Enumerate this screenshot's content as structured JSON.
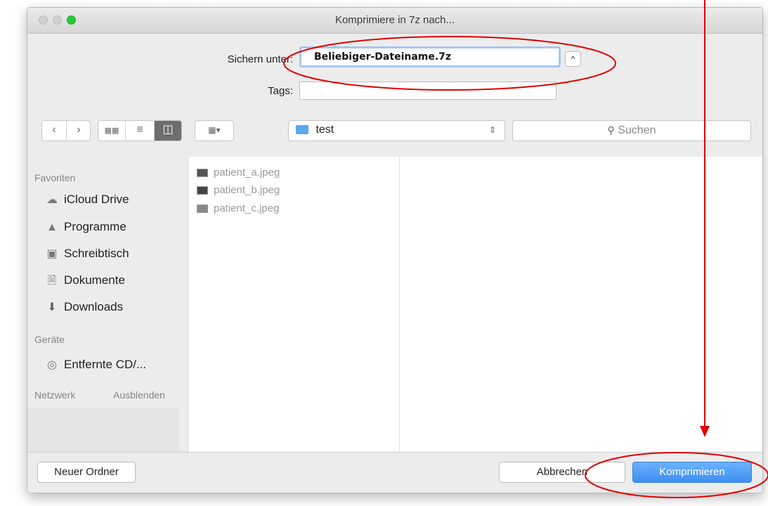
{
  "window": {
    "title": "Komprimiere in 7z nach..."
  },
  "save": {
    "label": "Sichern unter:",
    "filename": "Beliebiger-Dateiname.7z",
    "tags_label": "Tags:",
    "tags_value": ""
  },
  "toolbar": {
    "location": "test",
    "search_placeholder": "Suchen"
  },
  "sidebar": {
    "favorites_heading": "Favoriten",
    "favorites": [
      {
        "label": "iCloud Drive",
        "icon": "cloud-icon"
      },
      {
        "label": "Programme",
        "icon": "applications-icon"
      },
      {
        "label": "Schreibtisch",
        "icon": "desktop-icon"
      },
      {
        "label": "Dokumente",
        "icon": "documents-icon"
      },
      {
        "label": "Downloads",
        "icon": "download-icon"
      }
    ],
    "devices_heading": "Geräte",
    "devices": [
      {
        "label": "Entfernte CD/...",
        "icon": "disc-icon"
      }
    ],
    "network_heading": "Netzwerk",
    "hide_label": "Ausblenden"
  },
  "files": [
    {
      "name": "patient_a.jpeg"
    },
    {
      "name": "patient_b.jpeg"
    },
    {
      "name": "patient_c.jpeg"
    }
  ],
  "footer": {
    "new_folder": "Neuer Ordner",
    "cancel": "Abbrechen",
    "confirm": "Komprimieren"
  },
  "annotation": {
    "color": "#e00000"
  }
}
